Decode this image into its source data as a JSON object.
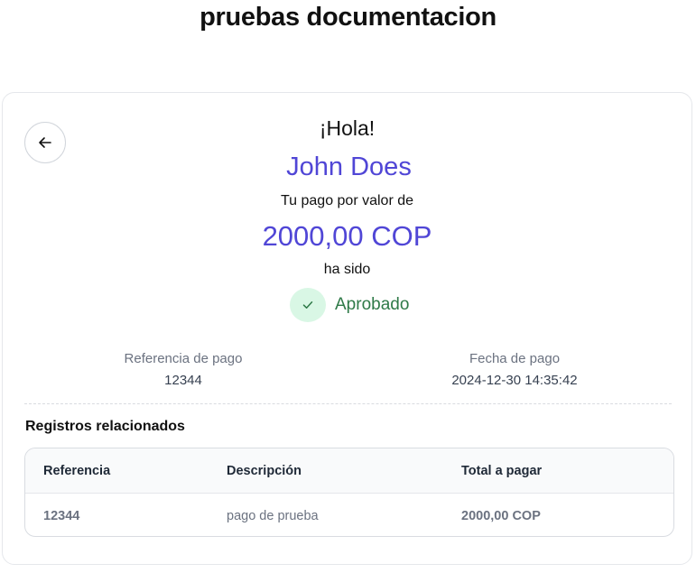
{
  "page": {
    "title": "pruebas documentacion"
  },
  "receipt": {
    "greeting": "¡Hola!",
    "user_name": "John Does",
    "pay_label": "Tu pago por valor de",
    "amount": "2000,00 COP",
    "status_prefix": "ha sido",
    "status": "Aprobado",
    "status_color": "#2f7a48",
    "accent_color": "#5046d6"
  },
  "details": {
    "reference_label": "Referencia de pago",
    "reference_value": "12344",
    "date_label": "Fecha de pago",
    "date_value": "2024-12-30 14:35:42"
  },
  "related": {
    "title": "Registros relacionados",
    "columns": [
      "Referencia",
      "Descripción",
      "Total a pagar"
    ],
    "rows": [
      [
        "12344",
        "pago de prueba",
        "2000,00 COP"
      ]
    ]
  },
  "icons": {
    "back": "arrow-left-icon",
    "status": "check-icon"
  }
}
